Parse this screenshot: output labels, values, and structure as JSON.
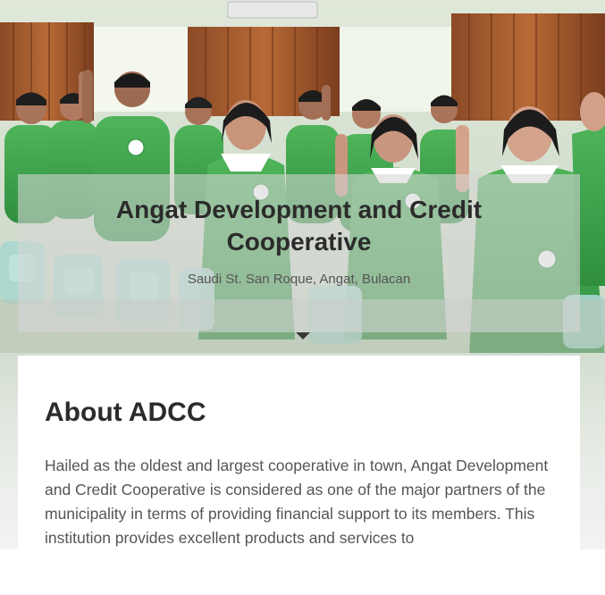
{
  "hero": {
    "title": "Angat Development and Credit Cooperative",
    "address": "Saudi St. San Roque, Angat, Bulacan"
  },
  "about": {
    "heading": "About ADCC",
    "body": "Hailed as the oldest and largest cooperative in town, Angat Development and Credit Cooperative is considered as one of the major partners of the municipality in terms of providing financial support to its members. This institution provides excellent products and services to"
  },
  "colors": {
    "uniform_green": "#3fa34d",
    "card_overlay": "#d6d6d6",
    "heading_text": "#2b2b2b",
    "body_text": "#555555"
  }
}
